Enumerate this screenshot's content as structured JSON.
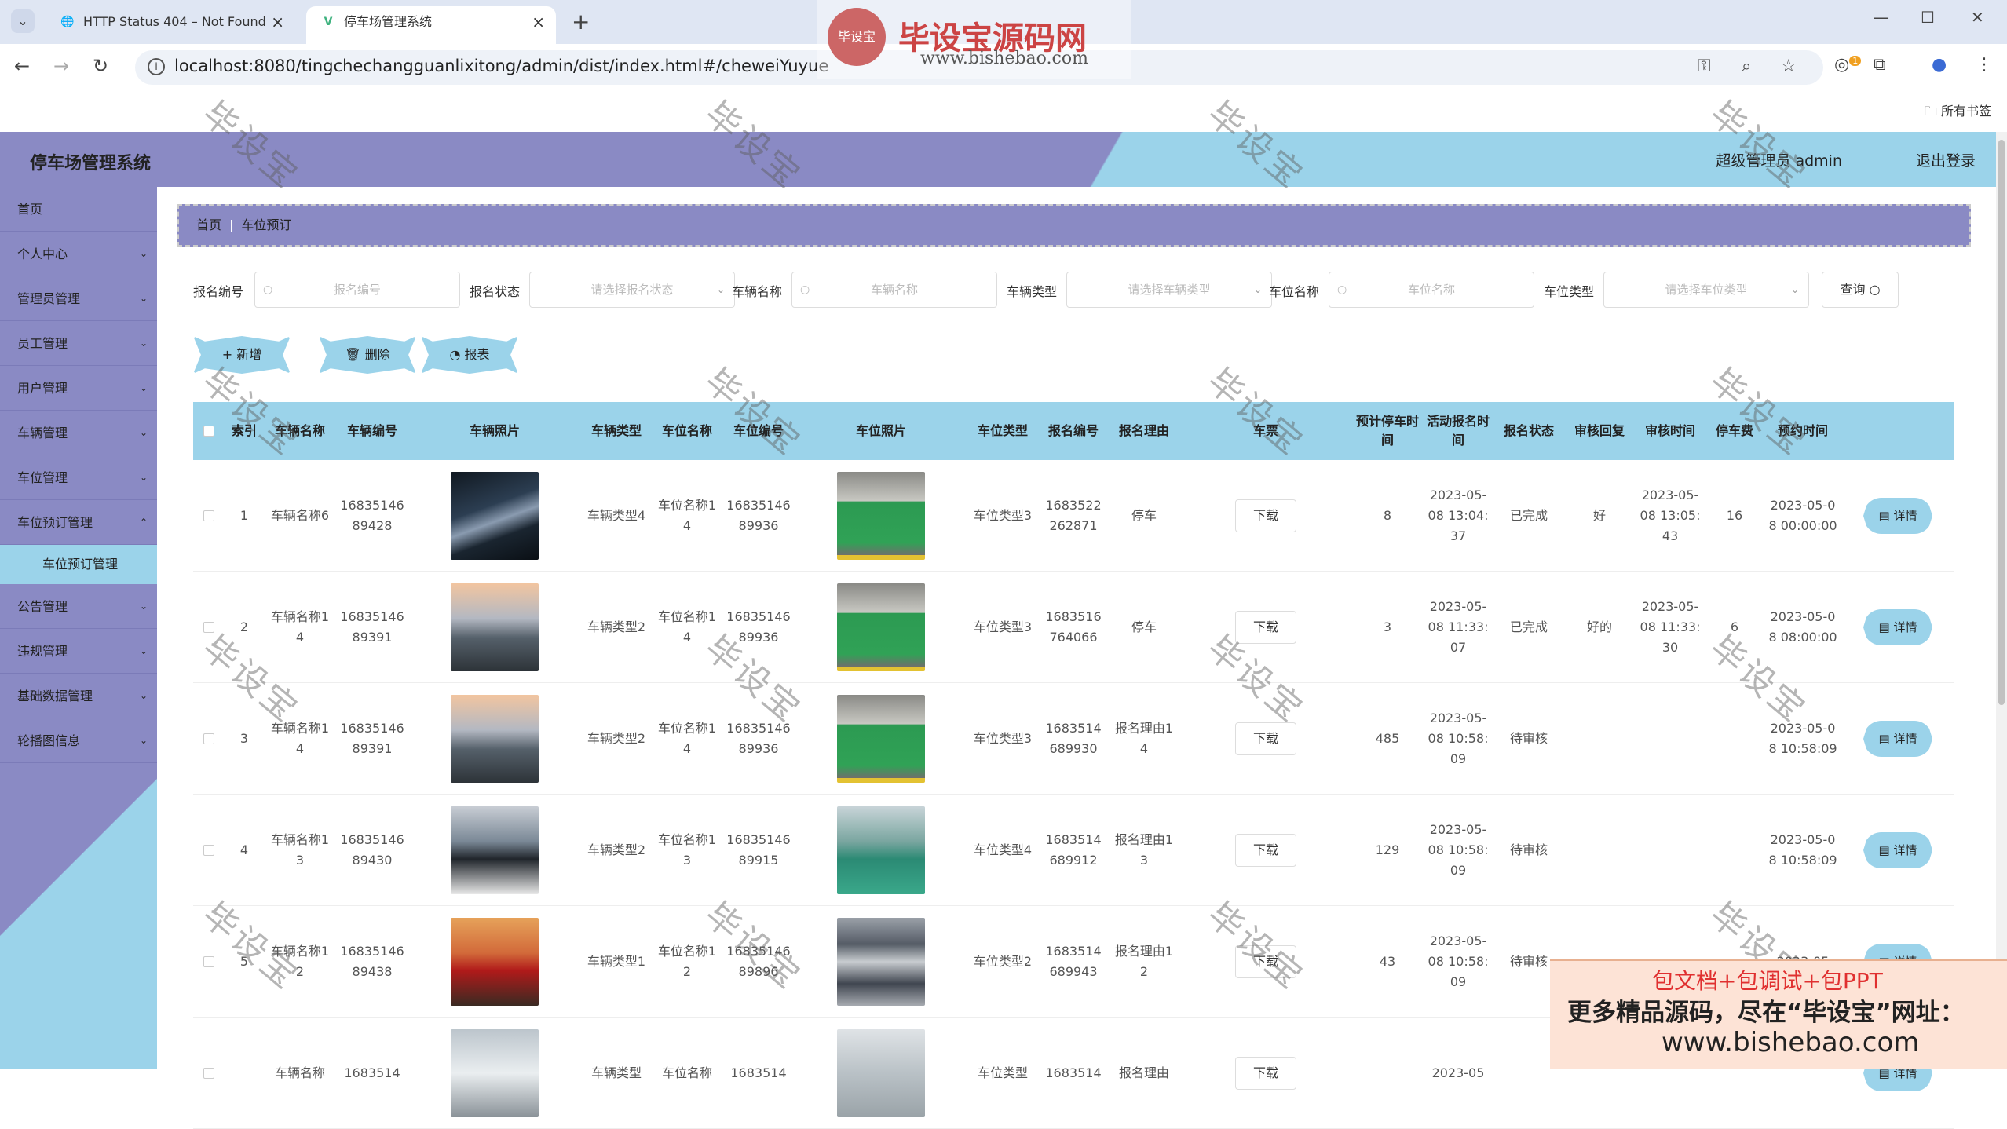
{
  "browser": {
    "tabs": [
      {
        "title": "HTTP Status 404 – Not Found",
        "icon": "globe-icon"
      },
      {
        "title": "停车场管理系统",
        "icon": "vue-icon"
      }
    ],
    "url": "localhost:8080/tingchechangguanlixitong/admin/dist/index.html#/cheweiYuyue",
    "bookmarks_label": "所有书签",
    "extension_badge": "1"
  },
  "watermark_site": {
    "title": "毕设宝源码网",
    "url": "www.bishebao.com",
    "logo_text": "毕设宝"
  },
  "header": {
    "brand": "停车场管理系统",
    "user": "超级管理员 admin",
    "logout": "退出登录"
  },
  "sidebar": {
    "items": [
      {
        "label": "首页",
        "has_chevron": false
      },
      {
        "label": "个人中心",
        "has_chevron": true
      },
      {
        "label": "管理员管理",
        "has_chevron": true
      },
      {
        "label": "员工管理",
        "has_chevron": true
      },
      {
        "label": "用户管理",
        "has_chevron": true
      },
      {
        "label": "车辆管理",
        "has_chevron": true
      },
      {
        "label": "车位管理",
        "has_chevron": true
      },
      {
        "label": "车位预订管理",
        "has_chevron": true
      },
      {
        "label": "公告管理",
        "has_chevron": true
      },
      {
        "label": "违规管理",
        "has_chevron": true
      },
      {
        "label": "基础数据管理",
        "has_chevron": true
      },
      {
        "label": "轮播图信息",
        "has_chevron": true
      }
    ],
    "active_sub": "车位预订管理"
  },
  "breadcrumb": {
    "home": "首页",
    "current": "车位预订"
  },
  "filters": {
    "baoming_bianhao": {
      "label": "报名编号",
      "placeholder": "报名编号"
    },
    "baoming_zhuangtai": {
      "label": "报名状态",
      "placeholder": "请选择报名状态"
    },
    "cheliang_mingcheng": {
      "label": "车辆名称",
      "placeholder": "车辆名称"
    },
    "cheliang_leixing": {
      "label": "车辆类型",
      "placeholder": "请选择车辆类型"
    },
    "chewei_mingcheng": {
      "label": "车位名称",
      "placeholder": "车位名称"
    },
    "chewei_leixing": {
      "label": "车位类型",
      "placeholder": "请选择车位类型"
    },
    "query_button": "查询"
  },
  "actions": {
    "add": "新增",
    "delete": "删除",
    "report": "报表"
  },
  "table": {
    "headers": [
      "索引",
      "车辆名称",
      "车辆编号",
      "车辆照片",
      "车辆类型",
      "车位名称",
      "车位编号",
      "车位照片",
      "车位类型",
      "报名编号",
      "报名理由",
      "车票",
      "预计停车时间",
      "活动报名时间",
      "报名状态",
      "审核回复",
      "审核时间",
      "停车费",
      "预约时间"
    ],
    "download_label": "下载",
    "detail_label": "详情",
    "rows": [
      {
        "index": "1",
        "car_name": "车辆名称6",
        "car_no": "1683514689428",
        "car_photo": "car1",
        "car_type": "车辆类型4",
        "space_name": "车位名称14",
        "space_no": "1683514689936",
        "space_photo": "park1",
        "space_type": "车位类型3",
        "signup_no": "1683522262871",
        "reason": "停车",
        "est_time": "8",
        "signup_time": "2023-05-08 13:04:37",
        "status": "已完成",
        "reply": "好",
        "review_time": "2023-05-08 13:05:43",
        "fee": "16",
        "book_time": "2023-05-08 00:00:00"
      },
      {
        "index": "2",
        "car_name": "车辆名称14",
        "car_no": "1683514689391",
        "car_photo": "car2",
        "car_type": "车辆类型2",
        "space_name": "车位名称14",
        "space_no": "1683514689936",
        "space_photo": "park1",
        "space_type": "车位类型3",
        "signup_no": "1683516764066",
        "reason": "停车",
        "est_time": "3",
        "signup_time": "2023-05-08 11:33:07",
        "status": "已完成",
        "reply": "好的",
        "review_time": "2023-05-08 11:33:30",
        "fee": "6",
        "book_time": "2023-05-08 08:00:00"
      },
      {
        "index": "3",
        "car_name": "车辆名称14",
        "car_no": "1683514689391",
        "car_photo": "car2",
        "car_type": "车辆类型2",
        "space_name": "车位名称14",
        "space_no": "1683514689936",
        "space_photo": "park1",
        "space_type": "车位类型3",
        "signup_no": "1683514689930",
        "reason": "报名理由14",
        "est_time": "485",
        "signup_time": "2023-05-08 10:58:09",
        "status": "待审核",
        "reply": "",
        "review_time": "",
        "fee": "",
        "book_time": "2023-05-08 10:58:09"
      },
      {
        "index": "4",
        "car_name": "车辆名称13",
        "car_no": "1683514689430",
        "car_photo": "car3",
        "car_type": "车辆类型2",
        "space_name": "车位名称13",
        "space_no": "1683514689915",
        "space_photo": "park2",
        "space_type": "车位类型4",
        "signup_no": "1683514689912",
        "reason": "报名理由13",
        "est_time": "129",
        "signup_time": "2023-05-08 10:58:09",
        "status": "待审核",
        "reply": "",
        "review_time": "",
        "fee": "",
        "book_time": "2023-05-08 10:58:09"
      },
      {
        "index": "5",
        "car_name": "车辆名称12",
        "car_no": "1683514689438",
        "car_photo": "car4",
        "car_type": "车辆类型1",
        "space_name": "车位名称12",
        "space_no": "1683514689896",
        "space_photo": "park3",
        "space_type": "车位类型2",
        "signup_no": "1683514689943",
        "reason": "报名理由12",
        "est_time": "43",
        "signup_time": "2023-05-08 10:58:09",
        "status": "待审核",
        "reply": "",
        "review_time": "",
        "fee": "",
        "book_time": "2023-05"
      },
      {
        "index": "",
        "car_name": "车辆名称",
        "car_no": "1683514",
        "car_photo": "car5",
        "car_type": "车辆类型",
        "space_name": "车位名称",
        "space_no": "1683514",
        "space_photo": "park4",
        "space_type": "车位类型",
        "signup_no": "1683514",
        "reason": "报名理由",
        "est_time": "",
        "signup_time": "2023-05",
        "status": "",
        "reply": "",
        "review_time": "",
        "fee": "",
        "book_time": ""
      }
    ]
  },
  "watermark_text": "毕设宝",
  "promo": {
    "line1": "包文档+包调试+包PPT",
    "line2": "更多精品源码，尽在“毕设宝”网址：",
    "line3": "www.bishebao.com"
  },
  "colors": {
    "purple": "#8a8ac4",
    "cyan": "#9bd3ea"
  }
}
